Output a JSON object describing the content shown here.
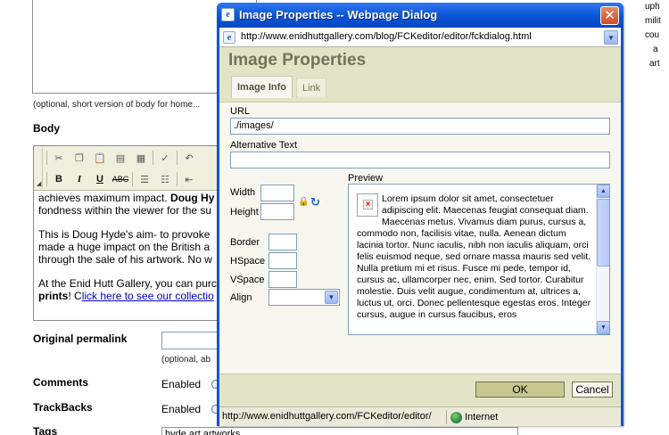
{
  "background": {
    "optional_note": "(optional, short version of body for home...",
    "body_label": "Body",
    "editor_paragraphs": [
      {
        "pre": "achieves maximum impact. ",
        "bold": "Doug Hy",
        "post": ""
      },
      {
        "pre": "fondness within the viewer for the su",
        "bold": "",
        "post": ""
      }
    ],
    "editor_paragraph2": [
      "This is Doug Hyde's aim- to provoke",
      "made a huge impact on the British a",
      "through the sale of his artwork. No w"
    ],
    "editor_paragraph3_line1": "At the Enid Hutt Gallery, you can purc",
    "editor_paragraph3_bold": "prints",
    "editor_paragraph3_sep": "! C",
    "editor_paragraph3_link": "lick here to see our collectio",
    "original_permalink_label": "Original permalink",
    "permalink_note": "(optional, ab",
    "comments_label": "Comments",
    "comments_value": "Enabled",
    "trackbacks_label": "TrackBacks",
    "trackbacks_value": "Enabled",
    "tags_label": "Tags",
    "tags_value": "hyde art artworks",
    "right_col": [
      "uph",
      "milit",
      "cou",
      "a",
      "art"
    ]
  },
  "dialog": {
    "title": "Image Properties -- Webpage Dialog",
    "address_url": "http://www.enidhuttgallery.com/blog/FCKeditor/editor/fckdialog.html",
    "heading": "Image Properties",
    "tabs": [
      "Image Info",
      "Link"
    ],
    "url_label": "URL",
    "url_value": "./images/",
    "alt_label": "Alternative Text",
    "alt_value": "",
    "width_label": "Width",
    "height_label": "Height",
    "border_label": "Border",
    "hspace_label": "HSpace",
    "vspace_label": "VSpace",
    "align_label": "Align",
    "align_value": "",
    "preview_label": "Preview",
    "preview_text": "Lorem ipsum dolor sit amet, consectetuer adipiscing elit. Maecenas feugiat consequat diam. Maecenas metus. Vivamus diam purus, cursus a, commodo non, facilisis vitae, nulla. Aenean dictum lacinia tortor. Nunc iaculis, nibh non iaculis aliquam, orci felis euismod neque, sed ornare massa mauris sed velit. Nulla pretium mi et risus. Fusce mi pede, tempor id, cursus ac, ullamcorper nec, enim. Sed tortor. Curabitur molestie. Duis velit augue, condimentum at, ultrices a, luctus ut, orci. Donec pellentesque egestas eros. Integer cursus, augue in cursus faucibus, eros",
    "ok_label": "OK",
    "cancel_label": "Cancel",
    "status_url": "http://www.enidhuttgallery.com/FCKeditor/editor/",
    "status_zone": "Internet"
  },
  "colors": {
    "titlebar": "#0a54d6",
    "panel": "#f7f7ef",
    "band": "#e3e3c7",
    "heading": "#737357",
    "ok_button": "#c7c78f",
    "close": "#d14c25"
  }
}
